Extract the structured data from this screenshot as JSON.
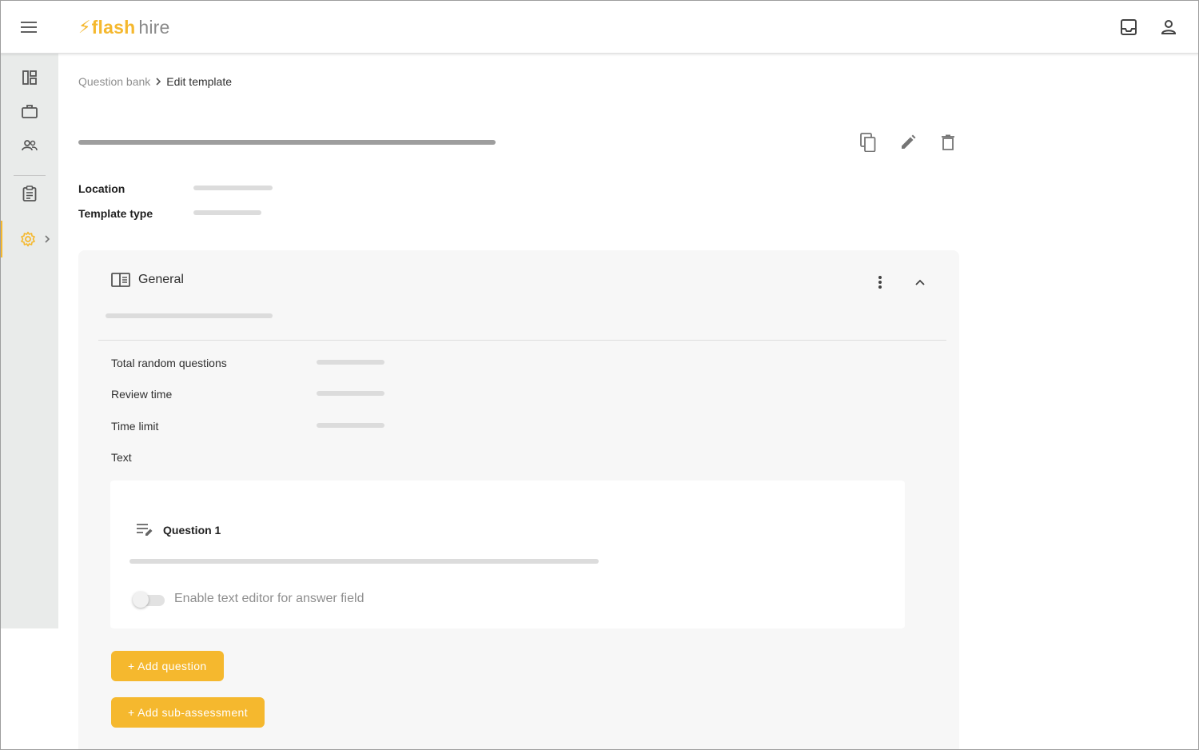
{
  "app": {
    "brand_flash": "flash",
    "brand_hire": "hire",
    "accent_color": "#f5b82e"
  },
  "topbar": {
    "icons": [
      "menu-icon",
      "inbox-icon",
      "account-icon"
    ]
  },
  "sidebar": {
    "items": [
      {
        "icon": "dashboard-icon"
      },
      {
        "icon": "briefcase-icon"
      },
      {
        "icon": "people-icon"
      },
      {
        "icon": "clipboard-icon"
      },
      {
        "icon": "settings-icon",
        "active": true
      }
    ]
  },
  "breadcrumb": {
    "parent": "Question bank",
    "current": "Edit template"
  },
  "template": {
    "actions": [
      "copy-icon",
      "edit-icon",
      "delete-icon"
    ],
    "fields": {
      "location_label": "Location",
      "template_type_label": "Template type"
    }
  },
  "section": {
    "title": "General",
    "rows": {
      "total_random": "Total random questions",
      "review_time": "Review time",
      "time_limit": "Time limit",
      "text": "Text"
    },
    "question": {
      "title": "Question 1",
      "toggle_label": "Enable text editor for answer field",
      "toggle_on": false
    },
    "buttons": {
      "add_question": "+ Add question",
      "add_sub_assessment": "+ Add sub-assessment"
    }
  }
}
